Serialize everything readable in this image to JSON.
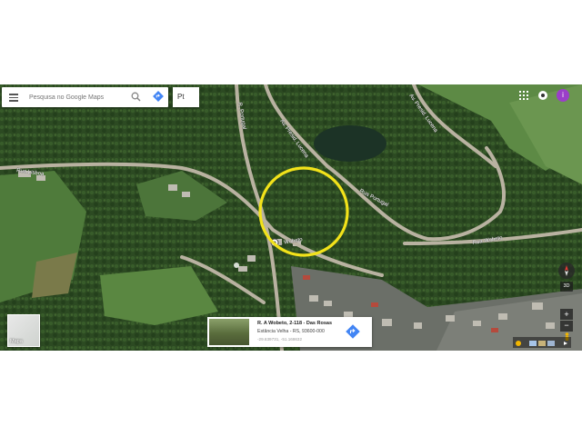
{
  "search": {
    "placeholder": "Pesquisa no Google Maps"
  },
  "language": {
    "label": "Pt"
  },
  "account": {
    "avatar_letter": "i",
    "avatar_color": "#9b3ec9"
  },
  "map": {
    "view": "satellite",
    "streets": [
      {
        "name": "Rua Lisboa"
      },
      {
        "name": "Av. Presid. Lucena"
      },
      {
        "name": "Av. Presid. Lucena"
      },
      {
        "name": "R. Portugal"
      },
      {
        "name": "Rua Portugal"
      },
      {
        "name": "R. Wobeto"
      },
      {
        "name": "Rua Wobeto"
      }
    ],
    "highlight": {
      "shape": "circle",
      "color": "#f2e21a"
    }
  },
  "layer_toggle": {
    "label": "Mapa"
  },
  "place_card": {
    "title": "R. A Wobeto, 2-118 - Das Rosas",
    "address": "Estância Velha - RS, 93600-000",
    "coords": "-29.639731, -51.168632"
  },
  "controls": {
    "tilt_label": "3D",
    "zoom_in": "+",
    "zoom_out": "−"
  },
  "colors": {
    "accent_blue": "#4285f4",
    "map_ui_dark": "#333333"
  }
}
